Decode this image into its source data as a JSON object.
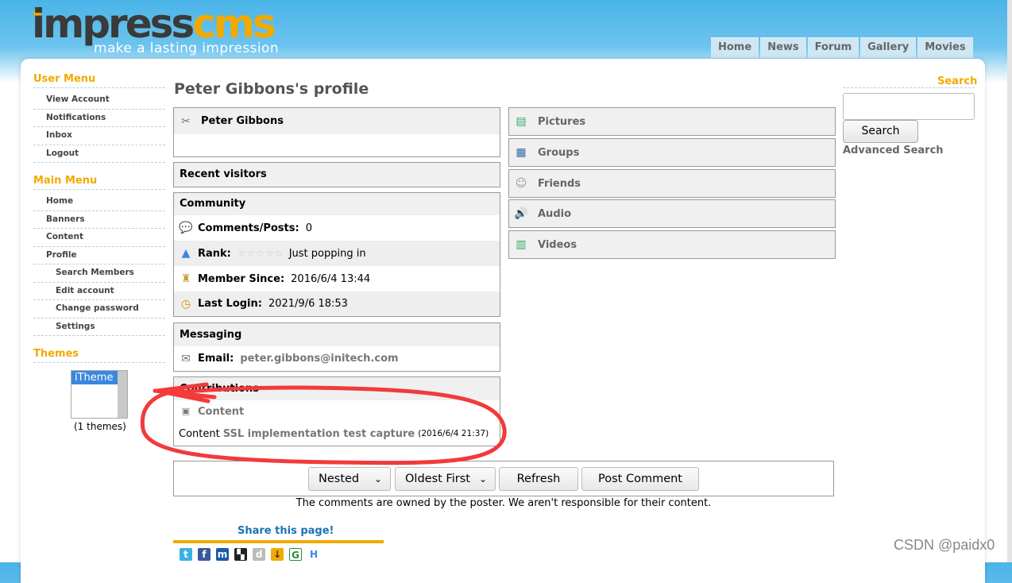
{
  "header": {
    "logo_word_1": "impress",
    "logo_word_2": "cms",
    "logo_tagline": "make a lasting impression",
    "nav": [
      "Home",
      "News",
      "Forum",
      "Gallery",
      "Movies"
    ]
  },
  "sidebar": {
    "user_menu_title": "User Menu",
    "user_menu": [
      "View Account",
      "Notifications",
      "Inbox",
      "Logout"
    ],
    "main_menu_title": "Main Menu",
    "main_menu": [
      {
        "label": "Home",
        "sub": false
      },
      {
        "label": "Banners",
        "sub": false
      },
      {
        "label": "Content",
        "sub": false
      },
      {
        "label": "Profile",
        "sub": false
      },
      {
        "label": "Search Members",
        "sub": true
      },
      {
        "label": "Edit account",
        "sub": true
      },
      {
        "label": "Change password",
        "sub": true
      },
      {
        "label": "Settings",
        "sub": true
      }
    ],
    "themes_title": "Themes",
    "theme_selected": "iTheme",
    "themes_count": "(1 themes)"
  },
  "profile": {
    "title": "Peter Gibbons's profile",
    "name": "Peter Gibbons",
    "recent_visitors": "Recent visitors",
    "community": {
      "title": "Community",
      "comments_label": "Comments/Posts:",
      "comments_value": "0",
      "rank_label": "Rank:",
      "rank_value": "Just popping in",
      "rank_stars": 0,
      "member_since_label": "Member Since:",
      "member_since_value": "2016/6/4 13:44",
      "last_login_label": "Last Login:",
      "last_login_value": "2021/9/6 18:53"
    },
    "messaging": {
      "title": "Messaging",
      "email_label": "Email:",
      "email_value": "peter.gibbons@initech.com"
    },
    "contributions": {
      "title": "Contributions",
      "module": "Content",
      "item_prefix": "Content",
      "item_link": "SSL implementation test capture",
      "item_date": "(2016/6/4 21:37)"
    }
  },
  "right_panels": [
    "Pictures",
    "Groups",
    "Friends",
    "Audio",
    "Videos"
  ],
  "search": {
    "title": "Search",
    "button": "Search",
    "placeholder": "",
    "advanced": "Advanced Search"
  },
  "comments": {
    "mode": "Nested",
    "order": "Oldest First",
    "refresh": "Refresh",
    "post": "Post Comment",
    "disclaimer": "The comments are owned by the poster. We aren't responsible for their content."
  },
  "share": {
    "title": "Share this page!",
    "icons": [
      "twitter-icon",
      "facebook-icon",
      "myspace-icon",
      "delicious-icon",
      "digg-icon",
      "stumble-icon",
      "google-icon",
      "hyves-icon"
    ]
  },
  "watermark": "CSDN @paidx0",
  "colors": {
    "accent": "#f2a900",
    "header_blue": "#4ab4e8",
    "link_blue": "#1a73b8",
    "annotation_red": "#f23a3a"
  }
}
